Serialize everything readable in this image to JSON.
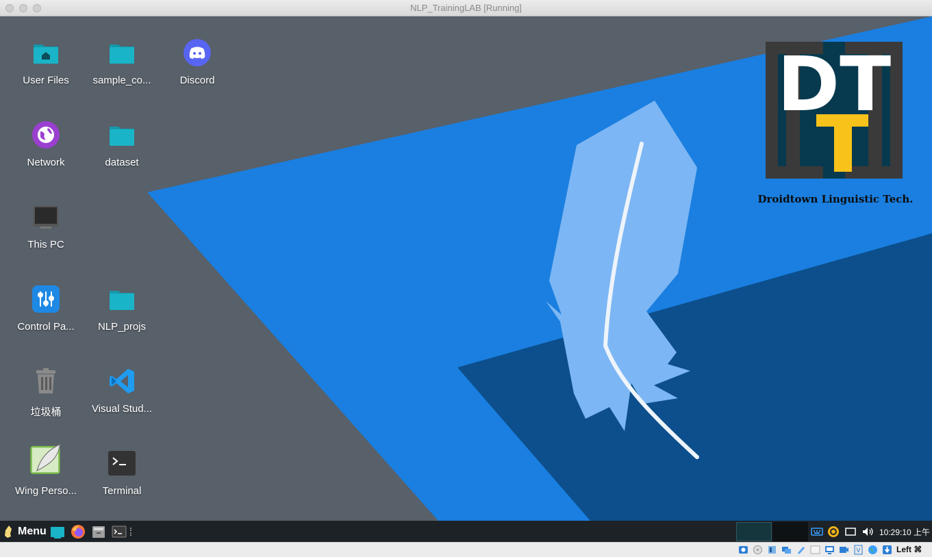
{
  "window": {
    "title": "NLP_TrainingLAB [Running]"
  },
  "desktop_icons": [
    {
      "label": "User Files",
      "icon": "home-folder-icon"
    },
    {
      "label": "sample_co...",
      "icon": "folder-icon"
    },
    {
      "label": "Discord",
      "icon": "discord-icon"
    },
    {
      "label": "Network",
      "icon": "network-icon"
    },
    {
      "label": "dataset",
      "icon": "folder-icon"
    },
    {
      "label": "This PC",
      "icon": "computer-icon"
    },
    {
      "label": "Control Pa...",
      "icon": "control-panel-icon"
    },
    {
      "label": "NLP_projs",
      "icon": "folder-icon"
    },
    {
      "label": "垃圾桶",
      "icon": "trash-icon"
    },
    {
      "label": "Visual Stud...",
      "icon": "vscode-icon"
    },
    {
      "label": "Wing Perso...",
      "icon": "wing-ide-icon"
    },
    {
      "label": "Terminal",
      "icon": "terminal-icon"
    }
  ],
  "wallpaper": {
    "logo_letters": "DT",
    "logo_caption": "Droidtown Linguistic Tech."
  },
  "taskbar": {
    "menu_label": "Menu",
    "apps": [
      "show-desktop-icon",
      "firefox-icon",
      "file-manager-icon",
      "terminal-icon"
    ],
    "clock": "10:29:10 上午",
    "tray": [
      "keyboard-icon",
      "updates-icon",
      "display-icon",
      "volume-icon"
    ]
  },
  "vbox": {
    "host_key": "Left ⌘",
    "indicators": [
      "hard-disk-icon",
      "optical-drive-icon",
      "audio-icon",
      "network-adapter-icon",
      "usb-icon",
      "shared-folders-icon",
      "display-icon",
      "recording-icon",
      "cpu-icon",
      "vt-x-icon",
      "mouse-integration-icon",
      "keyboard-capture-icon"
    ]
  },
  "colors": {
    "accent_blue": "#1a7fe0",
    "dark_blue": "#0c4f8c",
    "desktop_gray": "#586069",
    "folder": "#1ab4c8",
    "taskbar": "#1d2227"
  }
}
